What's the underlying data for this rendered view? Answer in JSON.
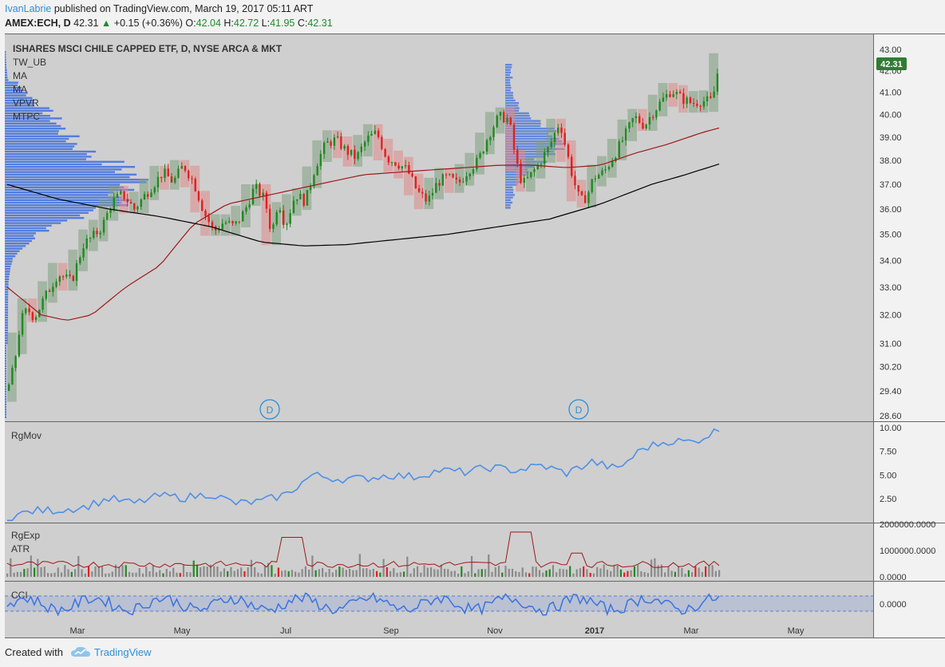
{
  "header": {
    "author": "IvanLabrie",
    "published_text": "published on TradingView.com, March 19, 2017 05:11 ART",
    "symbol": "AMEX:ECH, D",
    "last": "42.31",
    "change": "+0.15 (+0.36%)",
    "o_label": "O:",
    "o_value": "42.04",
    "h_label": "H:",
    "h_value": "42.72",
    "l_label": "L:",
    "l_value": "41.95",
    "c_label": "C:",
    "c_value": "42.31"
  },
  "main_pane": {
    "title": "ISHARES MSCI CHILE CAPPED ETF, D, NYSE ARCA & MKT",
    "indicators": [
      "TW_UB",
      "MA",
      "MA",
      "VPVR",
      "MTPC"
    ],
    "price_badge": "42.31",
    "dividend_marker": "D"
  },
  "rgmov_pane": {
    "label": "RgMov"
  },
  "rgexp_pane": {
    "label": "RgExp",
    "label2": "ATR"
  },
  "cci_pane": {
    "label": "CCI"
  },
  "footer": {
    "created_with": "Created with",
    "brand": "TradingView"
  },
  "colors": {
    "up": "#1f8a1f",
    "down": "#e02020",
    "box_up": "#7fa07f",
    "box_down": "#e08a8a",
    "ma_short": "#a01818",
    "ma_long": "#000000",
    "vp": "#3d6fe0",
    "rgmov": "#4f8fe8",
    "cci": "#3a73e0",
    "badge": "#2e7d32",
    "brand": "#2c8fd6"
  },
  "chart_data": [
    {
      "type": "candlestick",
      "title": "ISHARES MSCI CHILE CAPPED ETF, D, NYSE ARCA & MKT",
      "x_tick_labels": [
        "Mar",
        "May",
        "Jul",
        "Sep",
        "Nov",
        "2017",
        "Mar",
        "May"
      ],
      "y_tick_labels": [
        "43.00",
        "42.00",
        "41.00",
        "40.00",
        "39.00",
        "38.00",
        "37.00",
        "36.00",
        "35.00",
        "34.00",
        "33.00",
        "32.00",
        "31.00",
        "30.20",
        "29.40",
        "28.60"
      ],
      "scale": "log",
      "ylim": [
        28.6,
        43.0
      ],
      "close_path": [
        [
          0,
          29.4
        ],
        [
          4,
          30.2
        ],
        [
          8,
          31.8
        ],
        [
          12,
          32.2
        ],
        [
          16,
          31.9
        ],
        [
          22,
          32.6
        ],
        [
          30,
          33.5
        ],
        [
          38,
          33.2
        ],
        [
          45,
          34.6
        ],
        [
          52,
          35.0
        ],
        [
          56,
          35.3
        ],
        [
          62,
          36.3
        ],
        [
          68,
          36.6
        ],
        [
          75,
          36.0
        ],
        [
          84,
          36.8
        ],
        [
          92,
          37.5
        ],
        [
          98,
          37.1
        ],
        [
          104,
          37.8
        ],
        [
          110,
          37.1
        ],
        [
          116,
          35.9
        ],
        [
          122,
          35.1
        ],
        [
          128,
          35.5
        ],
        [
          134,
          35.3
        ],
        [
          140,
          35.9
        ],
        [
          146,
          36.9
        ],
        [
          152,
          36.4
        ],
        [
          156,
          35.0
        ],
        [
          160,
          36.4
        ],
        [
          164,
          35.3
        ],
        [
          170,
          36.6
        ],
        [
          176,
          36.3
        ],
        [
          182,
          37.8
        ],
        [
          188,
          38.7
        ],
        [
          194,
          38.9
        ],
        [
          200,
          38.4
        ],
        [
          206,
          38.1
        ],
        [
          212,
          38.9
        ],
        [
          218,
          39.2
        ],
        [
          224,
          38.1
        ],
        [
          230,
          37.9
        ],
        [
          236,
          37.6
        ],
        [
          242,
          36.7
        ],
        [
          248,
          36.3
        ],
        [
          254,
          37.1
        ],
        [
          260,
          37.3
        ],
        [
          266,
          37.0
        ],
        [
          272,
          37.6
        ],
        [
          278,
          38.0
        ],
        [
          284,
          39.1
        ],
        [
          290,
          39.9
        ],
        [
          296,
          39.8
        ],
        [
          300,
          38.0
        ],
        [
          304,
          37.0
        ],
        [
          308,
          37.3
        ],
        [
          314,
          37.9
        ],
        [
          320,
          38.6
        ],
        [
          326,
          39.7
        ],
        [
          330,
          38.4
        ],
        [
          334,
          37.2
        ],
        [
          338,
          36.3
        ],
        [
          342,
          36.5
        ],
        [
          346,
          37.3
        ],
        [
          352,
          37.5
        ],
        [
          358,
          38.2
        ],
        [
          364,
          39.0
        ],
        [
          370,
          39.9
        ],
        [
          376,
          39.5
        ],
        [
          380,
          40.0
        ],
        [
          386,
          40.6
        ],
        [
          392,
          41.1
        ],
        [
          398,
          40.7
        ],
        [
          404,
          40.5
        ],
        [
          410,
          40.6
        ],
        [
          416,
          40.6
        ],
        [
          420,
          42.31
        ]
      ],
      "ma_short_path": [
        [
          0,
          33.0
        ],
        [
          20,
          32.0
        ],
        [
          35,
          31.8
        ],
        [
          50,
          32.0
        ],
        [
          70,
          33.0
        ],
        [
          90,
          33.8
        ],
        [
          110,
          35.4
        ],
        [
          130,
          36.2
        ],
        [
          150,
          36.5
        ],
        [
          170,
          36.8
        ],
        [
          190,
          37.1
        ],
        [
          210,
          37.4
        ],
        [
          230,
          37.5
        ],
        [
          250,
          37.6
        ],
        [
          270,
          37.7
        ],
        [
          290,
          37.8
        ],
        [
          310,
          37.8
        ],
        [
          330,
          37.7
        ],
        [
          350,
          37.8
        ],
        [
          370,
          38.3
        ],
        [
          390,
          38.7
        ],
        [
          410,
          39.2
        ],
        [
          420,
          39.4
        ]
      ],
      "ma_long_path": [
        [
          0,
          37.0
        ],
        [
          30,
          36.4
        ],
        [
          60,
          36.0
        ],
        [
          90,
          35.7
        ],
        [
          120,
          35.3
        ],
        [
          150,
          34.7
        ],
        [
          175,
          34.55
        ],
        [
          200,
          34.6
        ],
        [
          230,
          34.8
        ],
        [
          260,
          35.0
        ],
        [
          290,
          35.3
        ],
        [
          320,
          35.6
        ],
        [
          350,
          36.2
        ],
        [
          380,
          37.0
        ],
        [
          400,
          37.4
        ],
        [
          420,
          37.85
        ]
      ]
    },
    {
      "type": "line",
      "name": "RgMov",
      "y_tick_labels": [
        "10.00",
        "7.50",
        "5.00",
        "2.50"
      ],
      "ylim": [
        0,
        10.5
      ],
      "path": [
        [
          0,
          0.5
        ],
        [
          15,
          1.2
        ],
        [
          30,
          1.3
        ],
        [
          45,
          1.6
        ],
        [
          60,
          2.5
        ],
        [
          75,
          2.0
        ],
        [
          90,
          2.8
        ],
        [
          105,
          2.6
        ],
        [
          120,
          3.0
        ],
        [
          135,
          2.0
        ],
        [
          150,
          2.2
        ],
        [
          165,
          3.0
        ],
        [
          180,
          5.0
        ],
        [
          195,
          4.6
        ],
        [
          210,
          4.6
        ],
        [
          225,
          5.0
        ],
        [
          240,
          4.8
        ],
        [
          255,
          5.5
        ],
        [
          270,
          5.3
        ],
        [
          285,
          5.8
        ],
        [
          300,
          5.5
        ],
        [
          315,
          6.0
        ],
        [
          330,
          5.2
        ],
        [
          345,
          6.4
        ],
        [
          360,
          5.6
        ],
        [
          375,
          7.8
        ],
        [
          390,
          8.6
        ],
        [
          405,
          8.5
        ],
        [
          420,
          9.8
        ]
      ]
    },
    {
      "type": "bar",
      "name": "RgExp / ATR",
      "y_tick_labels": [
        "2000000.0000",
        "1000000.0000",
        "0.0000"
      ],
      "ylim": [
        0,
        2000000
      ]
    },
    {
      "type": "line",
      "name": "CCI",
      "y_tick_labels": [
        "0.0000"
      ]
    }
  ]
}
